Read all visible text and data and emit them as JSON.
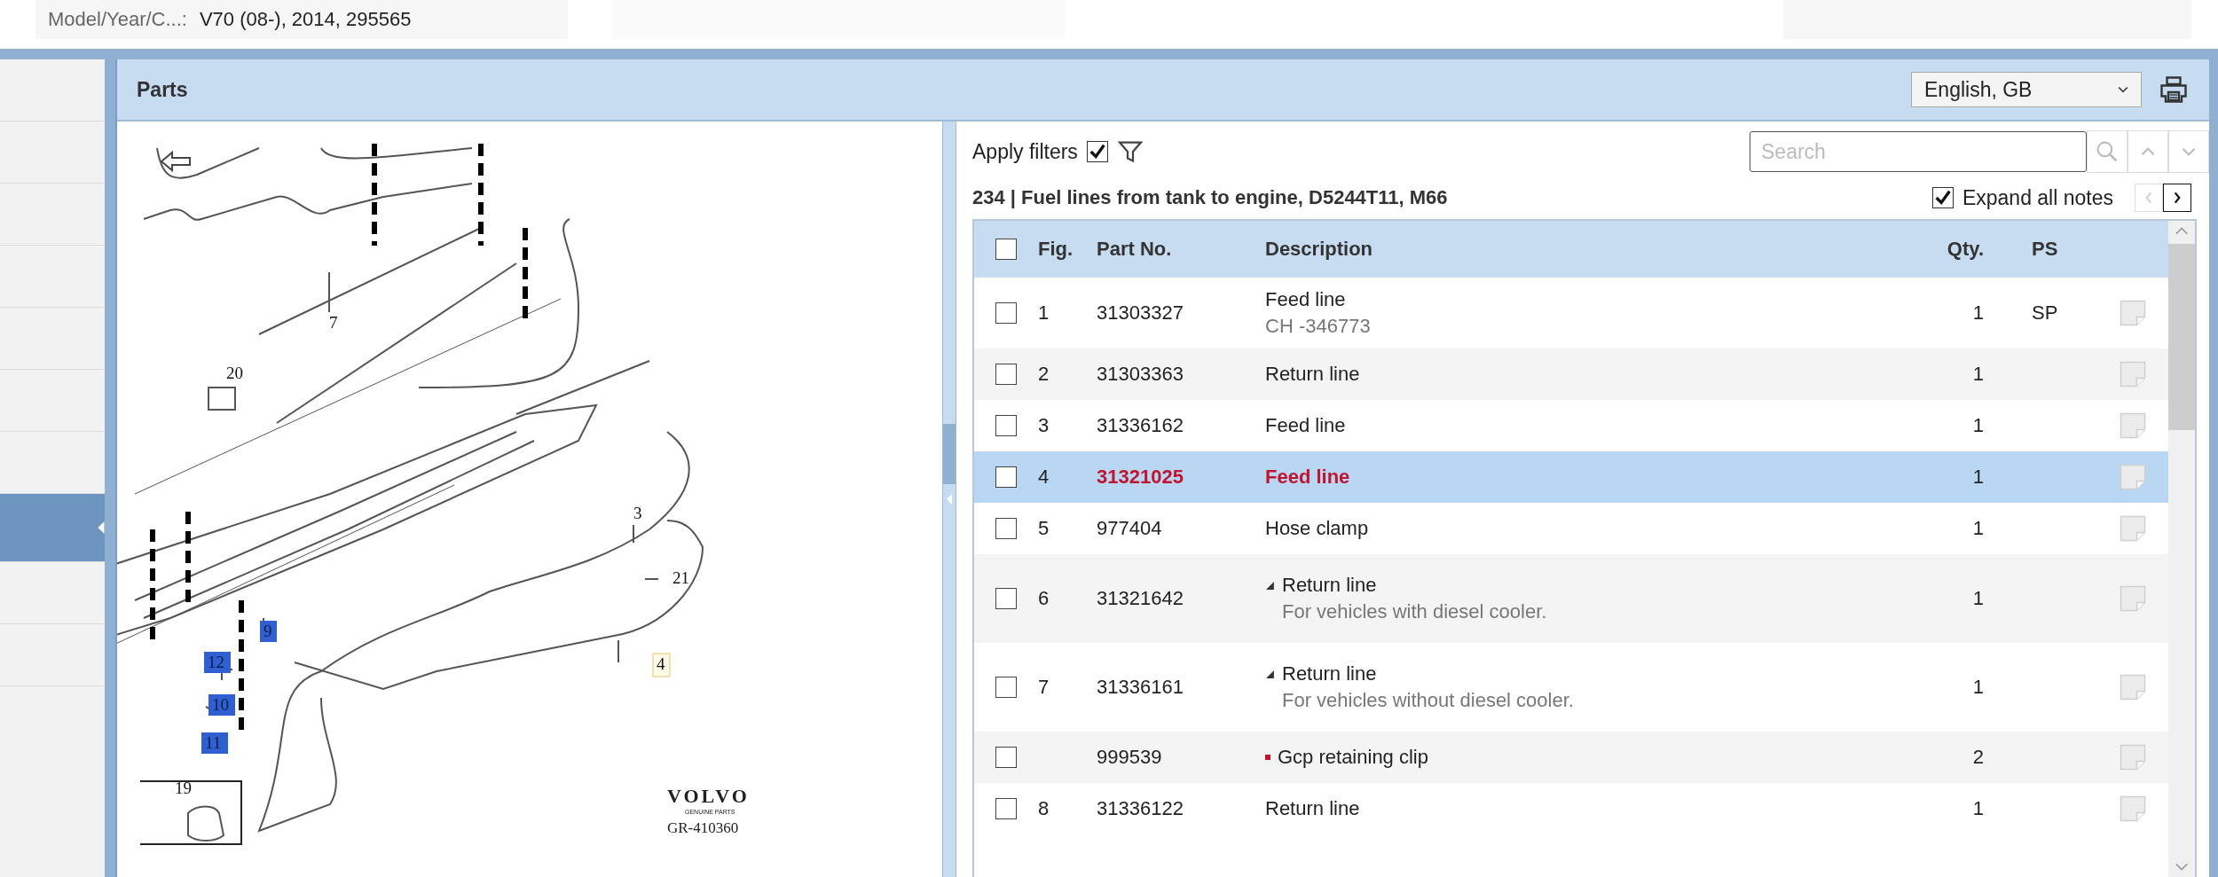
{
  "header": {
    "fields": [
      {
        "label": "Model/Year/C...:",
        "value": "V70 (08-), 2014, 295565"
      }
    ]
  },
  "sidebar": {
    "items": [
      {
        "selected": false
      },
      {
        "selected": false
      },
      {
        "selected": false
      },
      {
        "selected": false
      },
      {
        "selected": false
      },
      {
        "selected": false
      },
      {
        "selected": false
      },
      {
        "selected": true
      },
      {
        "selected": false
      },
      {
        "selected": false
      }
    ]
  },
  "panel": {
    "title": "Parts",
    "language": "English, GB"
  },
  "diagram": {
    "callouts": [
      {
        "label": "7",
        "kind": "plain"
      },
      {
        "label": "20",
        "kind": "plain"
      },
      {
        "label": "3",
        "kind": "plain"
      },
      {
        "label": "21",
        "kind": "plain"
      },
      {
        "label": "9",
        "kind": "highlighted"
      },
      {
        "label": "12",
        "kind": "highlighted"
      },
      {
        "label": "10",
        "kind": "highlighted"
      },
      {
        "label": "11",
        "kind": "highlighted"
      },
      {
        "label": "4",
        "kind": "current"
      },
      {
        "label": "19",
        "kind": "plain"
      }
    ],
    "logo": "VOLVO",
    "logo_sub": "GENUINE PARTS",
    "code": "GR-410360"
  },
  "parts_list": {
    "apply_filters": {
      "label": "Apply filters",
      "checked": true
    },
    "search": {
      "placeholder": "Search"
    },
    "title": "234  |  Fuel lines from tank to engine, D5244T11, M66",
    "expand_notes": {
      "label": "Expand all notes",
      "checked": true
    },
    "columns": [
      "Fig.",
      "Part No.",
      "Description",
      "Qty.",
      "PS"
    ],
    "select_all": {
      "checked": false
    },
    "rows": [
      {
        "fig": "1",
        "part_no": "31303327",
        "description": "Feed line",
        "note": "CH -346773",
        "qty": "1",
        "ps": "SP",
        "kind": "plain",
        "selected": false,
        "checked": false
      },
      {
        "fig": "2",
        "part_no": "31303363",
        "description": "Return line",
        "qty": "1",
        "kind": "plain",
        "selected": false,
        "checked": false
      },
      {
        "fig": "3",
        "part_no": "31336162",
        "description": "Feed line",
        "qty": "1",
        "kind": "plain",
        "selected": false,
        "checked": false
      },
      {
        "fig": "4",
        "part_no": "31321025",
        "description": "Feed line",
        "qty": "1",
        "kind": "plain",
        "selected": true,
        "checked": false
      },
      {
        "fig": "5",
        "part_no": "977404",
        "description": "Hose clamp",
        "qty": "1",
        "kind": "plain",
        "selected": false,
        "checked": false
      },
      {
        "fig": "6",
        "part_no": "31321642",
        "description": "Return line",
        "note": "For vehicles with diesel cooler.",
        "qty": "1",
        "kind": "expanded",
        "selected": false,
        "checked": false
      },
      {
        "fig": "7",
        "part_no": "31336161",
        "description": "Return line",
        "note": "For vehicles without diesel cooler.",
        "qty": "1",
        "kind": "expanded",
        "selected": false,
        "checked": false
      },
      {
        "part_no": "999539",
        "description": "Gcp retaining clip",
        "qty": "2",
        "kind": "accessory",
        "selected": false,
        "checked": false
      },
      {
        "fig": "8",
        "part_no": "31336122",
        "description": "Return line",
        "qty": "1",
        "kind": "plain",
        "selected": false,
        "checked": false
      }
    ]
  }
}
